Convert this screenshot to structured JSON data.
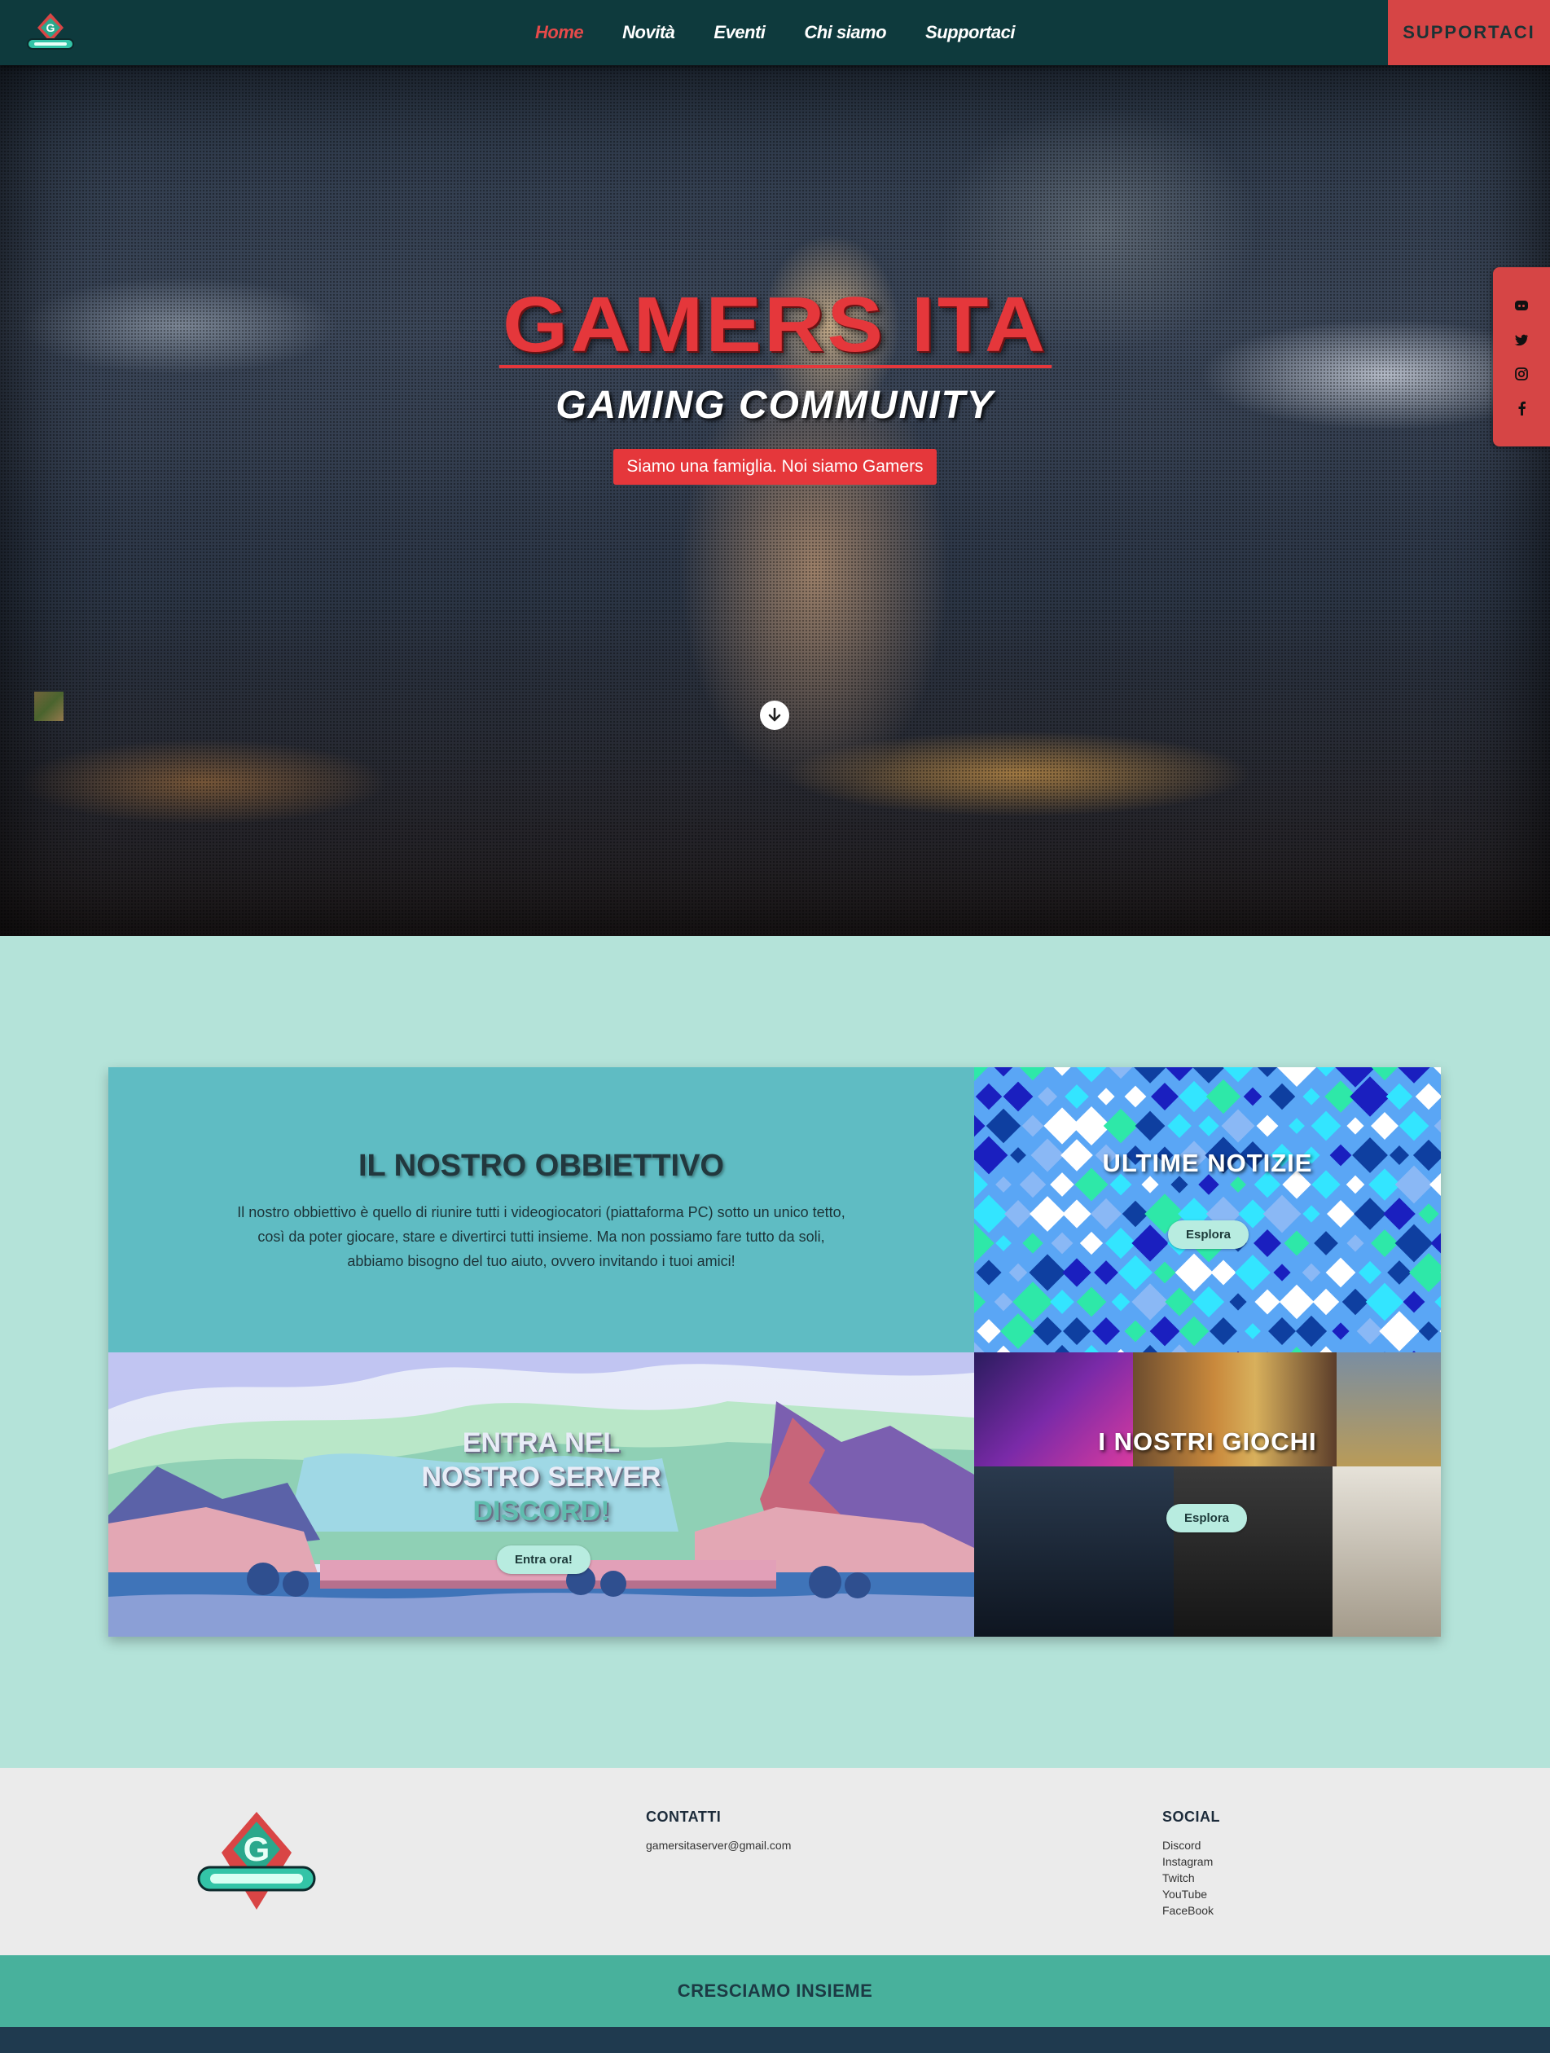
{
  "nav": {
    "links": [
      {
        "label": "Home",
        "active": true
      },
      {
        "label": "Novità",
        "active": false
      },
      {
        "label": "Eventi",
        "active": false
      },
      {
        "label": "Chi siamo",
        "active": false
      },
      {
        "label": "Supportaci",
        "active": false
      }
    ],
    "cta_label": "SUPPORTACI"
  },
  "hero": {
    "title": "GAMERS ITA",
    "subtitle": "GAMING COMMUNITY",
    "button_label": "Siamo una famiglia. Noi siamo Gamers"
  },
  "social_rail": [
    "discord-icon",
    "twitter-icon",
    "instagram-icon",
    "facebook-icon"
  ],
  "goal": {
    "title": "IL NOSTRO OBBIETTIVO",
    "text": "Il nostro obbiettivo è quello di riunire tutti i videogiocatori (piattaforma PC) sotto un unico tetto, così da poter giocare, stare e divertirci tutti insieme. Ma non possiamo fare tutto da soli, abbiamo bisogno del tuo aiuto, ovvero invitando i tuoi amici!"
  },
  "news": {
    "title": "ULTIME NOTIZIE",
    "button": "Esplora"
  },
  "discord": {
    "line1": "ENTRA NEL",
    "line2": "NOSTRO SERVER",
    "line3": "DISCORD!",
    "button": "Entra ora!"
  },
  "games": {
    "title": "I NOSTRI GIOCHI",
    "button": "Esplora"
  },
  "footer": {
    "contacts_title": "CONTATTI",
    "email": "gamersitaserver@gmail.com",
    "social_title": "SOCIAL",
    "social_links": [
      "Discord",
      "Instagram",
      "Twitch",
      "YouTube",
      "FaceBook"
    ],
    "band_text": "CRESCIAMO INSIEME"
  },
  "colors": {
    "nav_bg": "#0e3a3d",
    "accent_red": "#e5373b",
    "page_bg": "#b4e3d9",
    "teal_band": "#48b19c"
  }
}
